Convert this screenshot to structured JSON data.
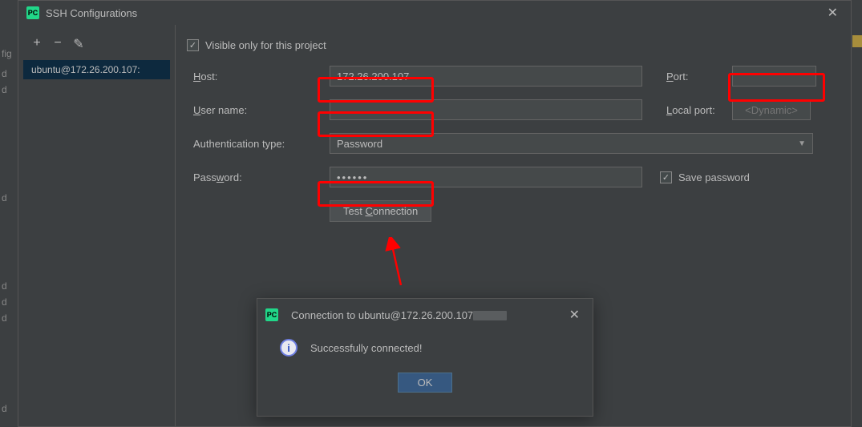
{
  "backdrop": {
    "fig": "fig",
    "d": "d"
  },
  "dialog": {
    "title": "SSH Configurations",
    "toolbar": {
      "add": "+",
      "remove": "−",
      "edit": "✎"
    },
    "list": {
      "item0": "ubuntu@172.26.200.107:"
    },
    "form": {
      "visible_only_label": "Visible only for this project",
      "host_label": "Host:",
      "host_value": "172.26.200.107",
      "port_label": "Port:",
      "port_value": "",
      "username_label": "User name:",
      "username_value": "",
      "localport_label": "Local port:",
      "localport_placeholder": "<Dynamic>",
      "authtype_label": "Authentication type:",
      "authtype_value": "Password",
      "password_label": "Password:",
      "password_value": "••••••",
      "save_password_label": "Save password",
      "test_connection_label": "Test Connection"
    }
  },
  "popup": {
    "title_prefix": "Connection to ubuntu@172.26.200.107",
    "message": "Successfully connected!",
    "ok": "OK"
  }
}
